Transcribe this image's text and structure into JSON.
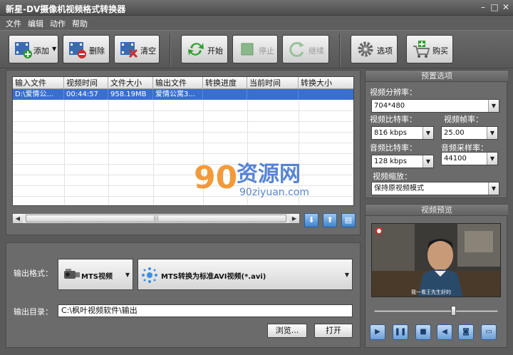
{
  "window": {
    "title": "新星-DV摄像机视频格式转换器"
  },
  "menu": [
    "文件",
    "编辑",
    "动作",
    "帮助"
  ],
  "toolbar": {
    "add": "添加",
    "delete": "删除",
    "clear": "清空",
    "start": "开始",
    "stop": "停止",
    "resume": "继续",
    "options": "选项",
    "buy": "购买"
  },
  "table": {
    "headers": [
      "输入文件",
      "视频时间",
      "文件大小",
      "输出文件",
      "转换进度",
      "当前时间",
      "转换大小"
    ],
    "rows": [
      [
        "D:\\爱情公...",
        "00:44:57",
        "958.19MB",
        "爱情公寓3...",
        "",
        "",
        ""
      ]
    ]
  },
  "output": {
    "format_label": "输出格式：",
    "device": "MTS视频",
    "profile": "MTS转换为标准AVI视频(*.avi)",
    "dir_label": "输出目录：",
    "dir_value": "C:\\枫叶视频软件\\输出",
    "browse": "浏览...",
    "open": "打开"
  },
  "preset": {
    "title": "预置选项",
    "resolution_label": "视频分辨率：",
    "resolution": "704*480",
    "vbitrate_label": "视频比特率：",
    "vbitrate": "816 kbps",
    "fps_label": "视频帧率：",
    "fps": "25.00",
    "abitrate_label": "音频比特率：",
    "abitrate": "128 kbps",
    "samplerate_label": "音频采样率：",
    "samplerate": "44100",
    "scale_label": "视频缩放：",
    "scale": "保持原视频模式"
  },
  "preview": {
    "title": "视频预览",
    "subtitle": "我一看王先生好的",
    "seek_position": 0.64
  },
  "watermark": {
    "text": "资源网",
    "number": "90",
    "url": "90ziyuan.com"
  },
  "colors": {
    "selection": "#3a6fd0",
    "panel": "#6b6b6b",
    "accent_orange": "#f28a1a"
  }
}
